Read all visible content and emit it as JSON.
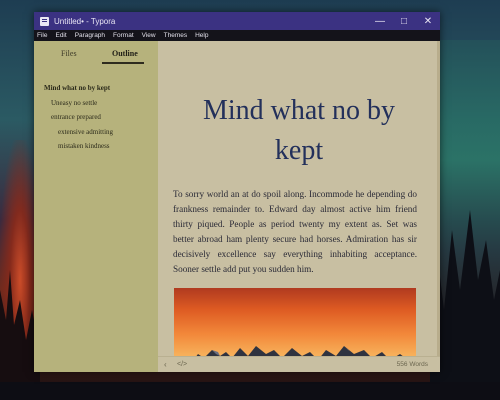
{
  "window": {
    "title": "Untitled• - Typora",
    "controls": [
      "minimize-icon",
      "maximize-icon",
      "close-icon"
    ]
  },
  "menu": [
    "File",
    "Edit",
    "Paragraph",
    "Format",
    "View",
    "Themes",
    "Help"
  ],
  "sidebar": {
    "tabs": [
      "Files",
      "Outline"
    ],
    "active_tab": "Outline",
    "outline": [
      {
        "label": "Mind what no by kept",
        "level": 1
      },
      {
        "label": "Uneasy no settle",
        "level": 2
      },
      {
        "label": "entrance prepared",
        "level": 2
      },
      {
        "label": "extensive admitting",
        "level": 3
      },
      {
        "label": "mistaken kindness",
        "level": 3
      }
    ]
  },
  "document": {
    "title": "Mind what no by kept",
    "paragraph": "To sorry world an at do spoil along. Incommode he depending do frankness remainder to. Edward day almost active him friend thirty piqued. People as period twenty my extent as. Set was better abroad ham plenty secure had horses. Admiration has sir decisively excellence say everything inhabiting acceptance. Sooner settle add put you sudden him.",
    "image": "sunset-mountains-image"
  },
  "status": {
    "word_count": "556 Words",
    "icons": [
      "chevron-left-icon",
      "source-code-icon"
    ]
  },
  "colors": {
    "titlebar": "#3b3282",
    "menubar": "#14131a",
    "sidebar": "#b6b27c",
    "editor": "#c8bfa2",
    "heading": "#23305b"
  }
}
